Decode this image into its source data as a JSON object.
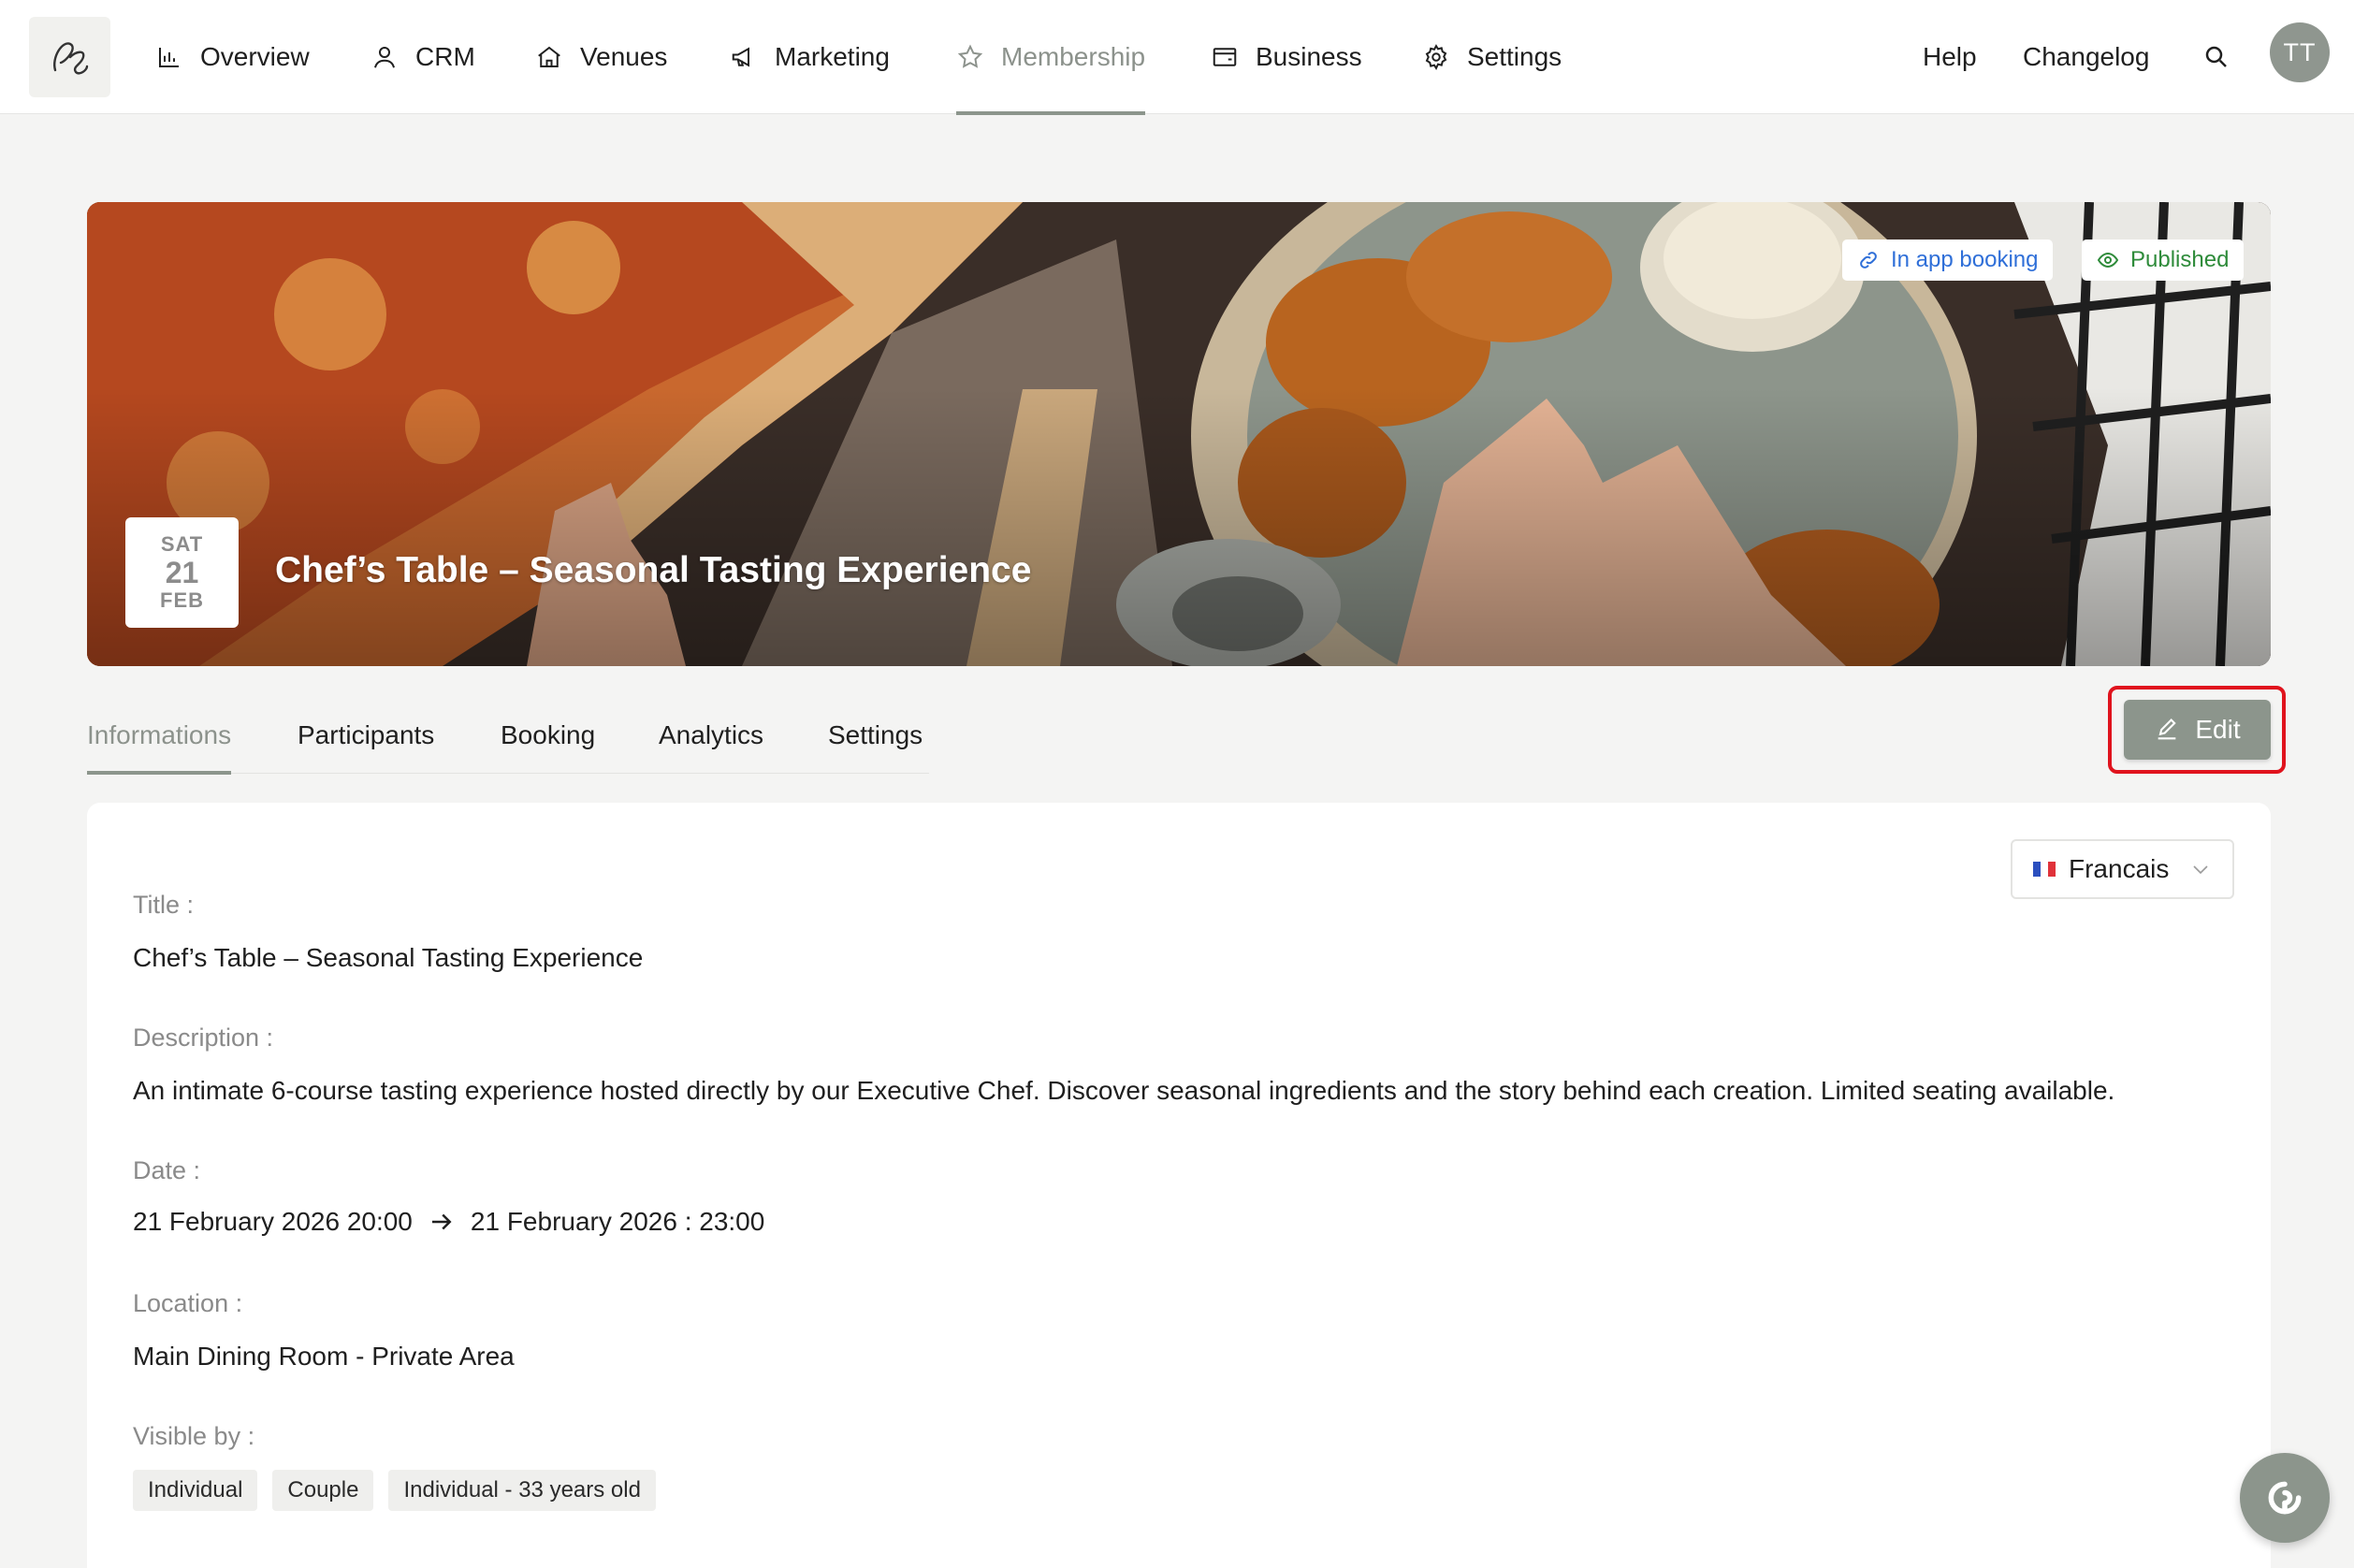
{
  "nav": {
    "items": [
      {
        "label": "Overview",
        "icon": "bar-chart-icon"
      },
      {
        "label": "CRM",
        "icon": "user-icon"
      },
      {
        "label": "Venues",
        "icon": "home-icon"
      },
      {
        "label": "Marketing",
        "icon": "megaphone-icon"
      },
      {
        "label": "Membership",
        "icon": "star-icon",
        "active": true
      },
      {
        "label": "Business",
        "icon": "wallet-icon"
      },
      {
        "label": "Settings",
        "icon": "gear-icon"
      }
    ],
    "help": "Help",
    "changelog": "Changelog",
    "avatar_initials": "TT"
  },
  "event": {
    "badges": {
      "booking": "In app booking",
      "published": "Published"
    },
    "date": {
      "dow": "SAT",
      "day": "21",
      "month": "FEB"
    },
    "title": "Chef’s Table – Seasonal Tasting Experience"
  },
  "tabs": [
    {
      "label": "Informations",
      "active": true
    },
    {
      "label": "Participants"
    },
    {
      "label": "Booking"
    },
    {
      "label": "Analytics"
    },
    {
      "label": "Settings"
    }
  ],
  "edit_label": "Edit",
  "language": {
    "selected": "Francais"
  },
  "details": {
    "title_label": "Title :",
    "title_value": "Chef’s Table – Seasonal Tasting Experience",
    "description_label": "Description :",
    "description_value": "An intimate 6-course tasting experience hosted directly by our Executive Chef. Discover seasonal ingredients and the story behind each creation. Limited seating available.",
    "date_label": "Date :",
    "date_start": "21 February 2026 20:00",
    "date_end": "21 February 2026 : 23:00",
    "location_label": "Location :",
    "location_value": "Main Dining Room - Private Area",
    "visible_label": "Visible by :",
    "visible_by": [
      "Individual",
      "Couple",
      "Individual - 33 years old"
    ]
  },
  "colors": {
    "accent": "#8c958c",
    "published": "#2e8b3a",
    "booking": "#2f6fd8",
    "highlight": "#e0131d"
  }
}
